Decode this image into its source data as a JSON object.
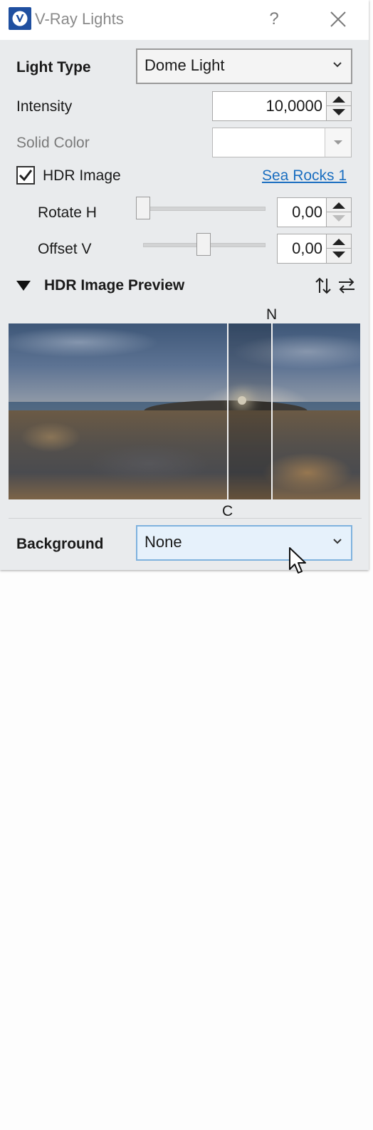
{
  "window": {
    "title": "V-Ray Lights",
    "help_label": "?"
  },
  "light_type": {
    "label": "Light Type",
    "value": "Dome Light"
  },
  "intensity": {
    "label": "Intensity",
    "value": "10,0000"
  },
  "solid_color": {
    "label": "Solid Color"
  },
  "hdr_image": {
    "label": "HDR Image",
    "checked": true,
    "link_text": "Sea Rocks 1"
  },
  "rotate_h": {
    "label": "Rotate H",
    "value": "0,00",
    "slider_fraction": 0.0
  },
  "offset_v": {
    "label": "Offset V",
    "value": "0,00",
    "slider_fraction": 0.5
  },
  "preview_section": {
    "title": "HDR Image Preview",
    "marker_north": "N",
    "marker_center": "C"
  },
  "background": {
    "label": "Background",
    "value": "None"
  },
  "colors": {
    "accent_link": "#1a6ec0",
    "dropdown_active_border": "#7fb2de",
    "logo": "#1f4fa0"
  },
  "icons": [
    "vray-logo-icon",
    "help-icon",
    "close-icon",
    "chevron-down-icon",
    "spinner-up-icon",
    "spinner-down-icon",
    "check-icon",
    "collapse-triangle-icon",
    "flip-vertical-icon",
    "flip-horizontal-icon",
    "mouse-cursor-icon"
  ]
}
